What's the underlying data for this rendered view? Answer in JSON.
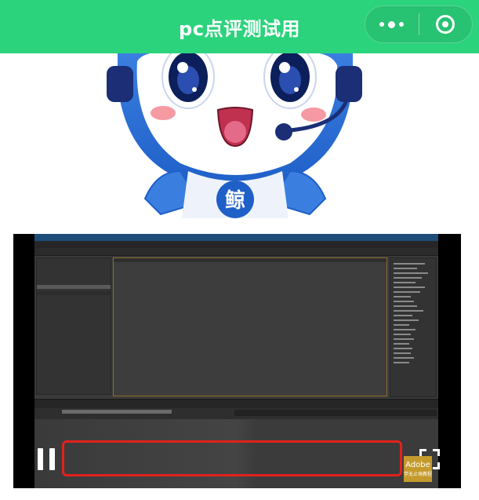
{
  "header": {
    "title": "pc点评测试用",
    "background": "#2bd37c",
    "capsule_icons": [
      "more-dots-icon",
      "close-target-icon"
    ]
  },
  "mascot": {
    "icon": "whale-mascot-icon",
    "chest_char": "鲸"
  },
  "video": {
    "state": "playing",
    "controls": [
      "pause-icon",
      "fullscreen-icon"
    ],
    "highlight_color": "#e2211c",
    "badge": {
      "line1": "Adobe",
      "line2": "学无止境教程"
    }
  }
}
